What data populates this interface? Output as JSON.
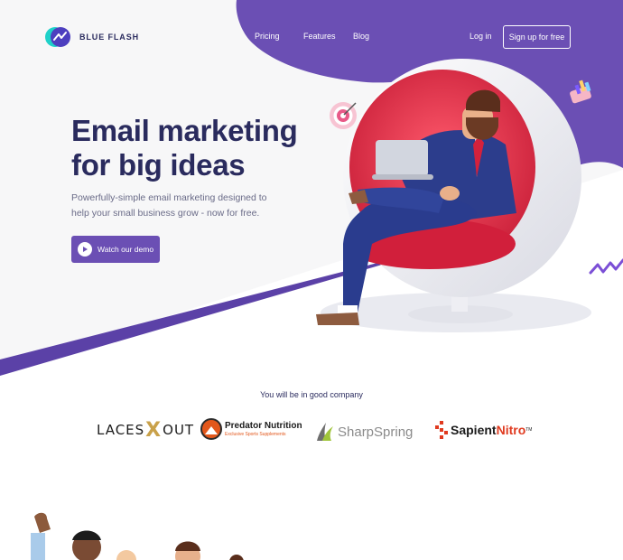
{
  "brand": {
    "name": "BLUE FLASH"
  },
  "nav": {
    "items": [
      "Pricing",
      "Features",
      "Blog"
    ],
    "login": "Log in",
    "signup": "Sign up for free"
  },
  "hero": {
    "title_line1": "Email marketing",
    "title_line2": "for big ideas",
    "subtitle_line1": "Powerfully-simple email marketing designed to",
    "subtitle_line2": "help your small business grow - now for free.",
    "cta": "Watch our demo"
  },
  "companies": {
    "title": "You will be in good company",
    "laces": {
      "left": "LACES",
      "mark": "X",
      "right": "OUT"
    },
    "predator": {
      "name": "Predator Nutrition",
      "tagline": "Exclusive Sports Supplements"
    },
    "sharpspring": {
      "name": "SharpSpring"
    },
    "sapient": {
      "part1": "Sapient",
      "part2": "Nitro",
      "tm": "TM"
    }
  },
  "icons": [
    "logo-mark-icon",
    "play-icon",
    "target-icon",
    "chart-gift-icon",
    "zigzag-icon",
    "person-in-egg-chair-illustration",
    "team-characters-illustration",
    "predator-logo-icon",
    "sharpspring-logo-icon",
    "sapient-logo-icon"
  ],
  "colors": {
    "primary": "#6b4fb4",
    "dark": "#2a2b5e",
    "text_muted": "#6a6b88",
    "pale_bg": "#f7f7f8",
    "chair_red": "#e2334d",
    "accent_gold": "#c9a14a",
    "accent_orange": "#e2571b"
  }
}
